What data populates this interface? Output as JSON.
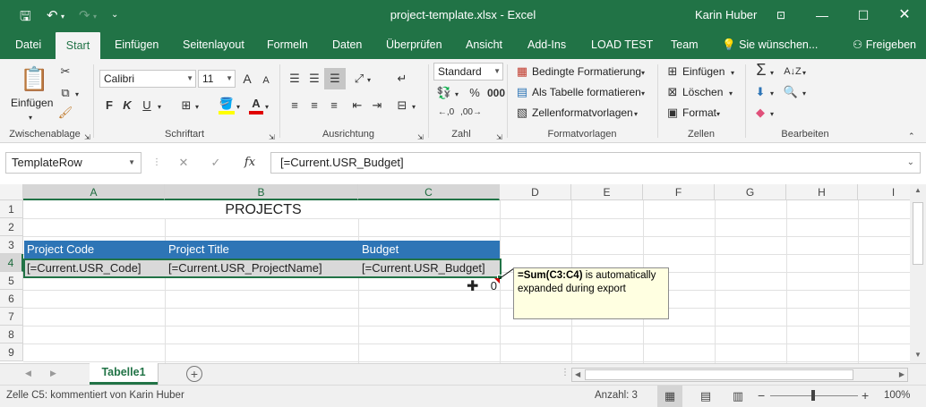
{
  "window": {
    "title": "project-template.xlsx  -  Excel",
    "user": "Karin Huber"
  },
  "menu": {
    "tabs": [
      "Datei",
      "Start",
      "Einfügen",
      "Seitenlayout",
      "Formeln",
      "Daten",
      "Überprüfen",
      "Ansicht",
      "Add-Ins",
      "LOAD TEST",
      "Team"
    ],
    "tell_me": "Sie wünschen...",
    "share": "Freigeben"
  },
  "ribbon": {
    "clipboard": {
      "paste_label": "Einfügen",
      "group_label": "Zwischenablage"
    },
    "font": {
      "name": "Calibri",
      "size": "11",
      "bold": "F",
      "italic": "K",
      "underline": "U",
      "grow": "A",
      "shrink": "A",
      "group_label": "Schriftart"
    },
    "alignment": {
      "group_label": "Ausrichtung"
    },
    "number": {
      "format": "Standard",
      "group_label": "Zahl"
    },
    "styles": {
      "conditional": "Bedingte Formatierung",
      "as_table": "Als Tabelle formatieren",
      "cell_styles": "Zellenformatvorlagen",
      "group_label": "Formatvorlagen"
    },
    "cells": {
      "insert": "Einfügen",
      "delete": "Löschen",
      "format": "Format",
      "group_label": "Zellen"
    },
    "editing": {
      "group_label": "Bearbeiten"
    }
  },
  "formula_bar": {
    "name_box": "TemplateRow",
    "fx": "fx",
    "content": "[=Current.USR_Budget]"
  },
  "grid": {
    "columns": [
      "A",
      "B",
      "C",
      "D",
      "E",
      "F",
      "G",
      "H",
      "I"
    ],
    "rows": [
      "1",
      "2",
      "3",
      "4",
      "5",
      "6",
      "7",
      "8",
      "9"
    ],
    "title_cell": "PROJECTS",
    "headers": [
      "Project Code",
      "Project Title",
      "Budget"
    ],
    "template_row": [
      "[=Current.USR_Code]",
      "[=Current.USR_ProjectName]",
      "[=Current.USR_Budget]"
    ],
    "c5_value": "0"
  },
  "comment": {
    "formula": "=Sum(C3:C4)",
    "text": " is automatically expanded during export"
  },
  "sheets": {
    "active": "Tabelle1"
  },
  "status": {
    "message": "Zelle C5: kommentiert von Karin Huber",
    "count": "Anzahl: 3",
    "zoom": "100%"
  },
  "colors": {
    "excel_green": "#217346",
    "table_header": "#2e75b6",
    "template_row": "#d9d9d9"
  }
}
